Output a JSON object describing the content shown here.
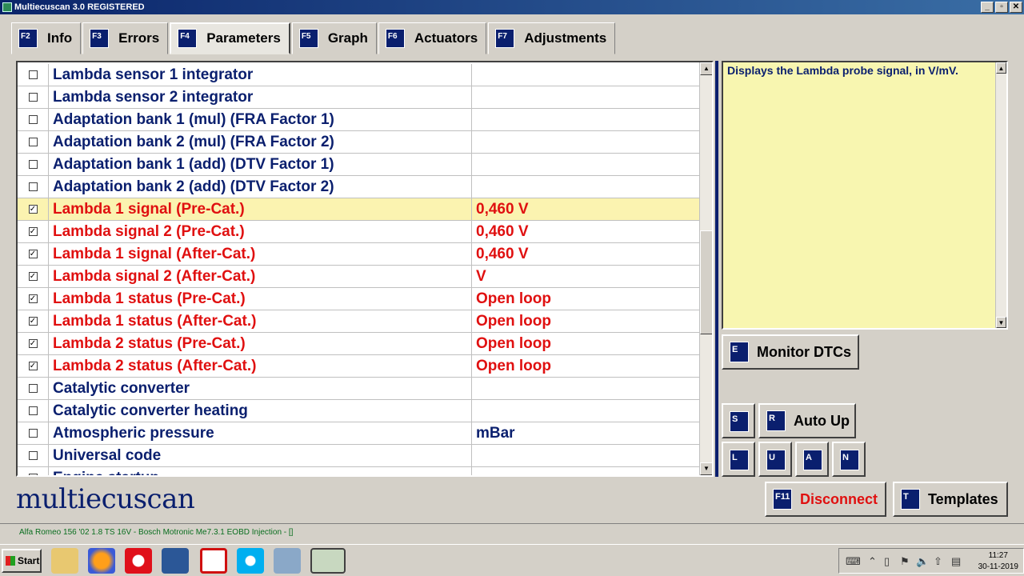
{
  "window": {
    "title": "Multiecuscan 3.0 REGISTERED",
    "controls": [
      "_",
      "▫",
      "✕"
    ]
  },
  "tabs": [
    {
      "key": "F2",
      "label": "Info"
    },
    {
      "key": "F3",
      "label": "Errors"
    },
    {
      "key": "F4",
      "label": "Parameters",
      "active": true
    },
    {
      "key": "F5",
      "label": "Graph"
    },
    {
      "key": "F6",
      "label": "Actuators"
    },
    {
      "key": "F7",
      "label": "Adjustments"
    }
  ],
  "parameters": [
    {
      "name": "Lambda sensor 1 integrator",
      "value": "",
      "checked": false
    },
    {
      "name": "Lambda sensor 2 integrator",
      "value": "",
      "checked": false
    },
    {
      "name": "Adaptation bank 1 (mul) (FRA Factor 1)",
      "value": "",
      "checked": false
    },
    {
      "name": "Adaptation bank 2 (mul) (FRA Factor 2)",
      "value": "",
      "checked": false
    },
    {
      "name": "Adaptation bank 1 (add) (DTV Factor 1)",
      "value": "",
      "checked": false
    },
    {
      "name": "Adaptation bank 2 (add) (DTV Factor 2)",
      "value": "",
      "checked": false
    },
    {
      "name": "Lambda 1 signal (Pre-Cat.)",
      "value": "0,460 V",
      "checked": true,
      "selected": true
    },
    {
      "name": "Lambda signal 2 (Pre-Cat.)",
      "value": "0,460 V",
      "checked": true
    },
    {
      "name": "Lambda 1 signal (After-Cat.)",
      "value": "0,460 V",
      "checked": true
    },
    {
      "name": "Lambda signal 2 (After-Cat.)",
      "value": " V",
      "checked": true
    },
    {
      "name": "Lambda 1 status (Pre-Cat.)",
      "value": "Open loop",
      "checked": true
    },
    {
      "name": "Lambda 1 status (After-Cat.)",
      "value": "Open loop",
      "checked": true
    },
    {
      "name": "Lambda 2 status (Pre-Cat.)",
      "value": "Open loop",
      "checked": true
    },
    {
      "name": "Lambda 2 status (After-Cat.)",
      "value": "Open loop",
      "checked": true
    },
    {
      "name": "Catalytic converter",
      "value": "",
      "checked": false
    },
    {
      "name": "Catalytic converter heating",
      "value": "",
      "checked": false
    },
    {
      "name": "Atmospheric pressure",
      "value": " mBar",
      "checked": false
    },
    {
      "name": "Universal code",
      "value": "",
      "checked": false
    },
    {
      "name": "Engine startup",
      "value": "",
      "checked": false
    }
  ],
  "description": "Displays the Lambda probe signal, in V/mV.",
  "buttons": {
    "monitor_dtcs": {
      "key": "E",
      "label": "Monitor DTCs"
    },
    "s": {
      "key": "S"
    },
    "auto_up": {
      "key": "R",
      "label": "Auto Up"
    },
    "l": {
      "key": "L"
    },
    "u": {
      "key": "U"
    },
    "a": {
      "key": "A"
    },
    "n": {
      "key": "N"
    },
    "disconnect": {
      "key": "F11",
      "label": "Disconnect"
    },
    "templates": {
      "key": "T",
      "label": "Templates"
    }
  },
  "logo": "multiecuscan",
  "status_text": "Alfa Romeo 156 '02 1.8 TS 16V - Bosch Motronic Me7.3.1 EOBD Injection - []",
  "taskbar": {
    "start_label": "Start",
    "time": "11:27",
    "date": "30-11-2019"
  },
  "colors": {
    "accent": "#0a1f6e",
    "active_value": "#e01010",
    "selected_row": "#fbf3b0",
    "description_bg": "#f8f6b0"
  }
}
